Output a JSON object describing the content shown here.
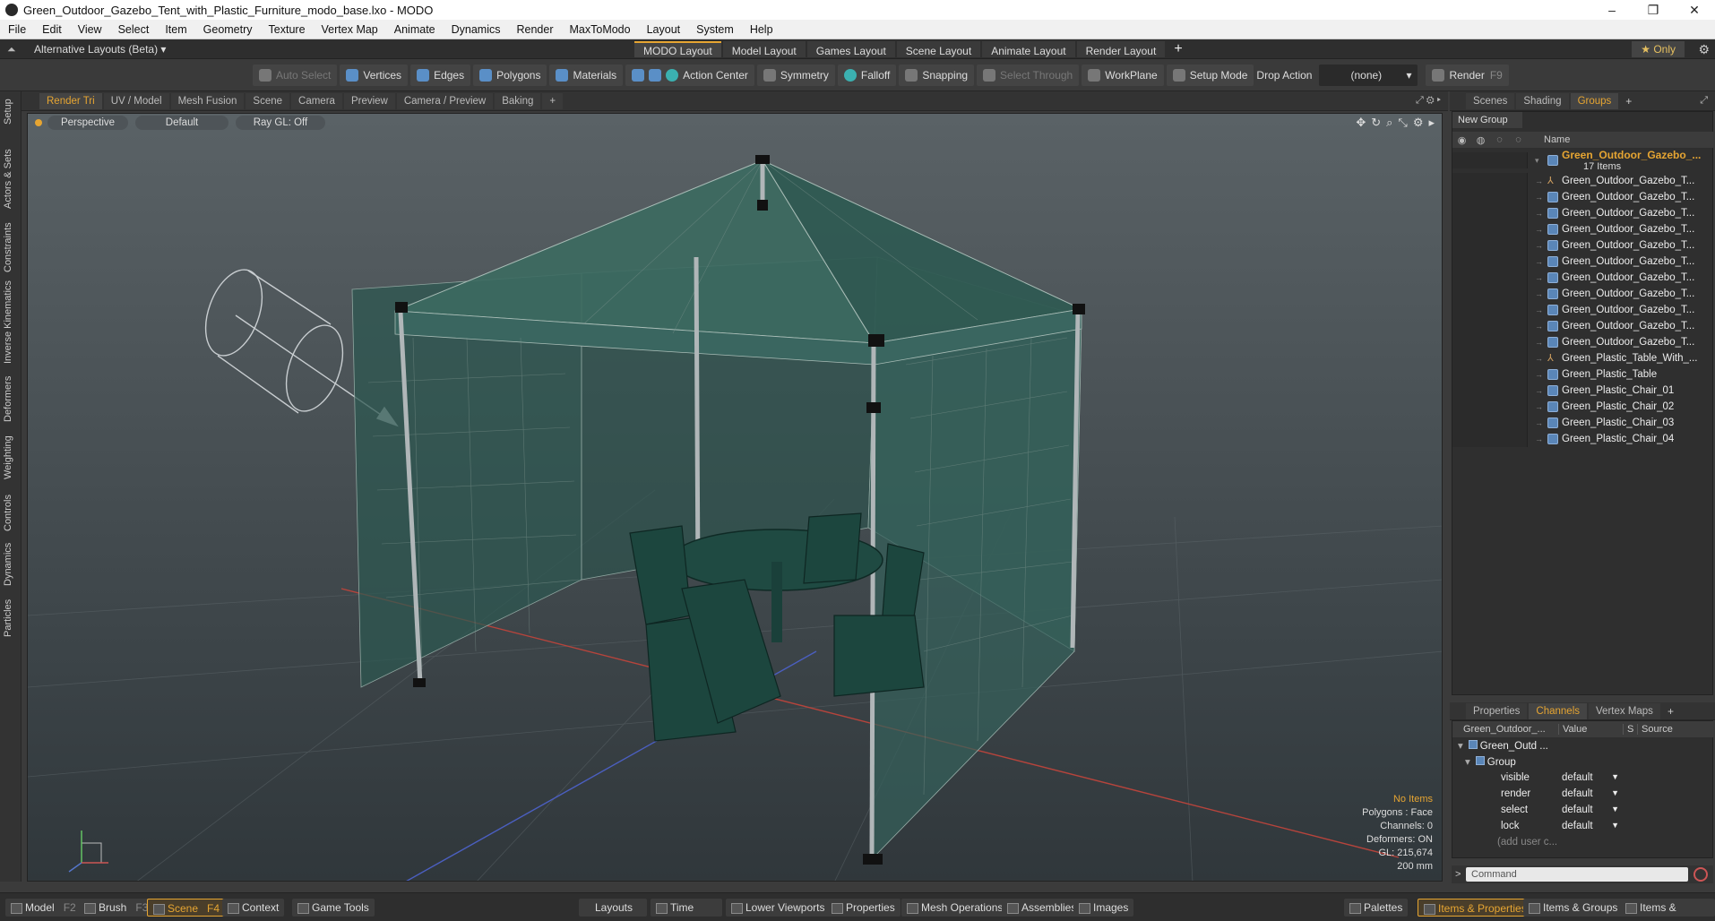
{
  "window": {
    "title": "Green_Outdoor_Gazebo_Tent_with_Plastic_Furniture_modo_base.lxo - MODO",
    "minimize": "–",
    "restore": "❐",
    "close": "✕"
  },
  "menu": [
    "File",
    "Edit",
    "View",
    "Select",
    "Item",
    "Geometry",
    "Texture",
    "Vertex Map",
    "Animate",
    "Dynamics",
    "Render",
    "MaxToModo",
    "Layout",
    "System",
    "Help"
  ],
  "layouts": {
    "alternative": "Alternative Layouts (Beta) ▾",
    "tabs": [
      "MODO Layout",
      "Model Layout",
      "Games Layout",
      "Scene Layout",
      "Animate Layout",
      "Render Layout"
    ],
    "active_tab": 0,
    "plus": "+",
    "only": "★  Only",
    "gear": "⚙"
  },
  "toolbar": {
    "auto_select": "Auto Select",
    "vertices": "Vertices",
    "edges": "Edges",
    "polygons": "Polygons",
    "materials": "Materials",
    "action_center": "Action Center",
    "symmetry": "Symmetry",
    "falloff": "Falloff",
    "snapping": "Snapping",
    "select_through": "Select Through",
    "workplane": "WorkPlane",
    "setup_mode": "Setup Mode",
    "drop_action": "Drop Action",
    "drop_value": "(none)",
    "render": "Render",
    "render_key": "F9"
  },
  "left_tabs": [
    "Setup",
    "Actors & Sets",
    "Constraints",
    "Inverse Kinematics",
    "Deformers",
    "Weighting",
    "Controls",
    "Dynamics",
    "Particles"
  ],
  "viewport_tabs": [
    "Render Tri",
    "UV / Model",
    "Mesh Fusion",
    "Scene",
    "Camera",
    "Preview",
    "Camera / Preview",
    "Baking",
    "+"
  ],
  "viewport": {
    "view": "Perspective",
    "shading": "Default",
    "raygl": "Ray GL: Off",
    "info": {
      "items": "No Items",
      "polygons": "Polygons : Face",
      "channels": "Channels: 0",
      "deformers": "Deformers: ON",
      "gl": "GL: 215,674",
      "scale": "200 mm"
    }
  },
  "right_tabs": [
    "Scenes",
    "Shading",
    "Groups",
    "+"
  ],
  "groups": {
    "new_group": "New Group",
    "name_header": "Name",
    "top": {
      "name": "Green_Outdoor_Gazebo_...",
      "count": "17 Items"
    },
    "items": [
      {
        "name": "Green_Outdoor_Gazebo_T...",
        "kind": "loc"
      },
      {
        "name": "Green_Outdoor_Gazebo_T...",
        "kind": "mesh"
      },
      {
        "name": "Green_Outdoor_Gazebo_T...",
        "kind": "mesh"
      },
      {
        "name": "Green_Outdoor_Gazebo_T...",
        "kind": "mesh"
      },
      {
        "name": "Green_Outdoor_Gazebo_T...",
        "kind": "mesh"
      },
      {
        "name": "Green_Outdoor_Gazebo_T...",
        "kind": "mesh"
      },
      {
        "name": "Green_Outdoor_Gazebo_T...",
        "kind": "mesh"
      },
      {
        "name": "Green_Outdoor_Gazebo_T...",
        "kind": "mesh"
      },
      {
        "name": "Green_Outdoor_Gazebo_T...",
        "kind": "mesh"
      },
      {
        "name": "Green_Outdoor_Gazebo_T...",
        "kind": "mesh"
      },
      {
        "name": "Green_Outdoor_Gazebo_T...",
        "kind": "mesh"
      },
      {
        "name": "Green_Plastic_Table_With_...",
        "kind": "loc"
      },
      {
        "name": "Green_Plastic_Table",
        "kind": "mesh"
      },
      {
        "name": "Green_Plastic_Chair_01",
        "kind": "mesh"
      },
      {
        "name": "Green_Plastic_Chair_02",
        "kind": "mesh"
      },
      {
        "name": "Green_Plastic_Chair_03",
        "kind": "mesh"
      },
      {
        "name": "Green_Plastic_Chair_04",
        "kind": "mesh"
      }
    ]
  },
  "lower_tabs": [
    "Properties",
    "Channels",
    "Vertex Maps",
    "+"
  ],
  "channels": {
    "header": {
      "name": "Green_Outdoor_...",
      "value": "Value",
      "s": "S",
      "source": "Source"
    },
    "root": "Green_Outd ...",
    "group": "Group",
    "rows": [
      {
        "name": "visible",
        "value": "default"
      },
      {
        "name": "render",
        "value": "default"
      },
      {
        "name": "select",
        "value": "default"
      },
      {
        "name": "lock",
        "value": "default"
      }
    ],
    "add_user": "(add user c..."
  },
  "command": {
    "prompt": ">",
    "placeholder": "Command"
  },
  "bottom": {
    "model": "Model",
    "model_key": "F2",
    "brush": "Brush",
    "brush_key": "F3",
    "scene": "Scene",
    "scene_key": "F4",
    "context": "Context",
    "game_tools": "Game Tools",
    "layouts": "Layouts",
    "time": "Time",
    "lower_viewports": "Lower Viewports",
    "properties": "Properties",
    "mesh_operations": "Mesh Operations",
    "assemblies": "Assemblies",
    "images": "Images",
    "palettes": "Palettes",
    "items_properties": "Items & Properties",
    "items_groups": "Items & Groups",
    "items_shading": "Items & Shading"
  },
  "colors": {
    "accent": "#e6a532",
    "tent": "#2f5a52",
    "furniture": "#1e4a42"
  }
}
